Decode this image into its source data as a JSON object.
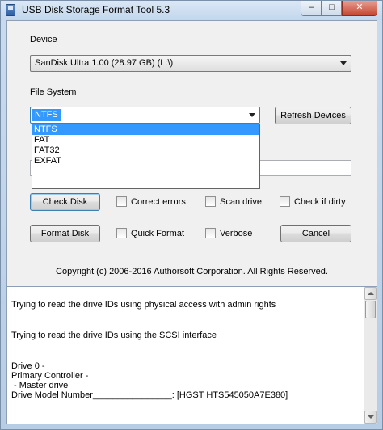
{
  "window": {
    "title": "USB Disk Storage Format Tool 5.3",
    "controls": {
      "minimize": "–",
      "maximize": "□",
      "close": "✕"
    }
  },
  "device": {
    "label": "Device",
    "selected": "SanDisk  Ultra  1.00 (28.97 GB) (L:\\)"
  },
  "file_system": {
    "label": "File System",
    "selected": "NTFS",
    "options": [
      "NTFS",
      "FAT",
      "FAT32",
      "EXFAT"
    ]
  },
  "buttons": {
    "refresh": "Refresh Devices",
    "check_disk": "Check Disk",
    "format_disk": "Format Disk",
    "cancel": "Cancel"
  },
  "checkboxes": {
    "correct_errors": "Correct errors",
    "scan_drive": "Scan drive",
    "check_if_dirty": "Check if dirty",
    "quick_format": "Quick Format",
    "verbose": "Verbose"
  },
  "volume_label": {
    "value": ""
  },
  "copyright": "Copyright (c) 2006-2016 Authorsoft Corporation. All Rights Reserved.",
  "log": [
    "Trying to read the drive IDs using physical access with admin rights",
    "Trying to read the drive IDs using the SCSI interface",
    "Drive 0 -",
    "Primary Controller -",
    " - Master drive",
    "Drive Model Number________________: [HGST HTS545050A7E380]"
  ]
}
